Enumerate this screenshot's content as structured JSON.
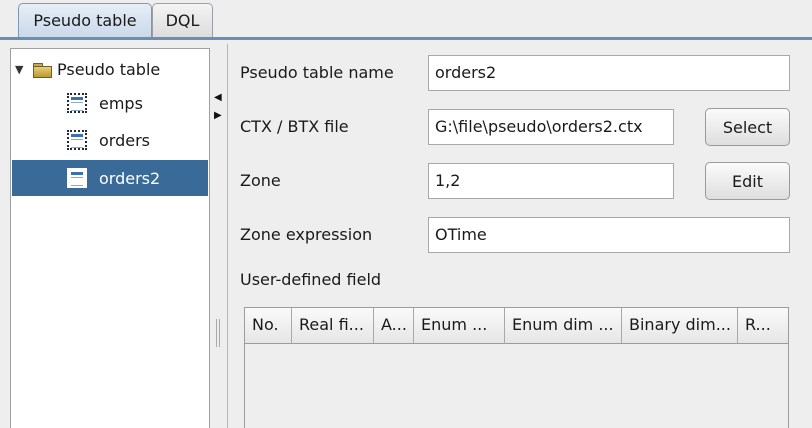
{
  "tabs": [
    {
      "label": "Pseudo table",
      "active": true
    },
    {
      "label": "DQL",
      "active": false
    }
  ],
  "tree": {
    "root_label": "Pseudo table",
    "items": [
      {
        "label": "emps",
        "selected": false
      },
      {
        "label": "orders",
        "selected": false
      },
      {
        "label": "orders2",
        "selected": true
      }
    ]
  },
  "form": {
    "pseudo_table_name": {
      "label": "Pseudo table name",
      "value": "orders2"
    },
    "ctx_btx_file": {
      "label": "CTX / BTX file",
      "value": "G:\\file\\pseudo\\orders2.ctx",
      "button": "Select"
    },
    "zone": {
      "label": "Zone",
      "value": "1,2",
      "button": "Edit"
    },
    "zone_expression": {
      "label": "Zone expression",
      "value": "OTime"
    },
    "user_defined_field_label": "User-defined field"
  },
  "field_table": {
    "columns": [
      "No.",
      "Real fi...",
      "A...",
      "Enum ...",
      "Enum dim ...",
      "Binary dim...",
      "R..."
    ],
    "rows": []
  },
  "colors": {
    "accent": "#6a8fb5",
    "selection": "#3a6b98"
  }
}
